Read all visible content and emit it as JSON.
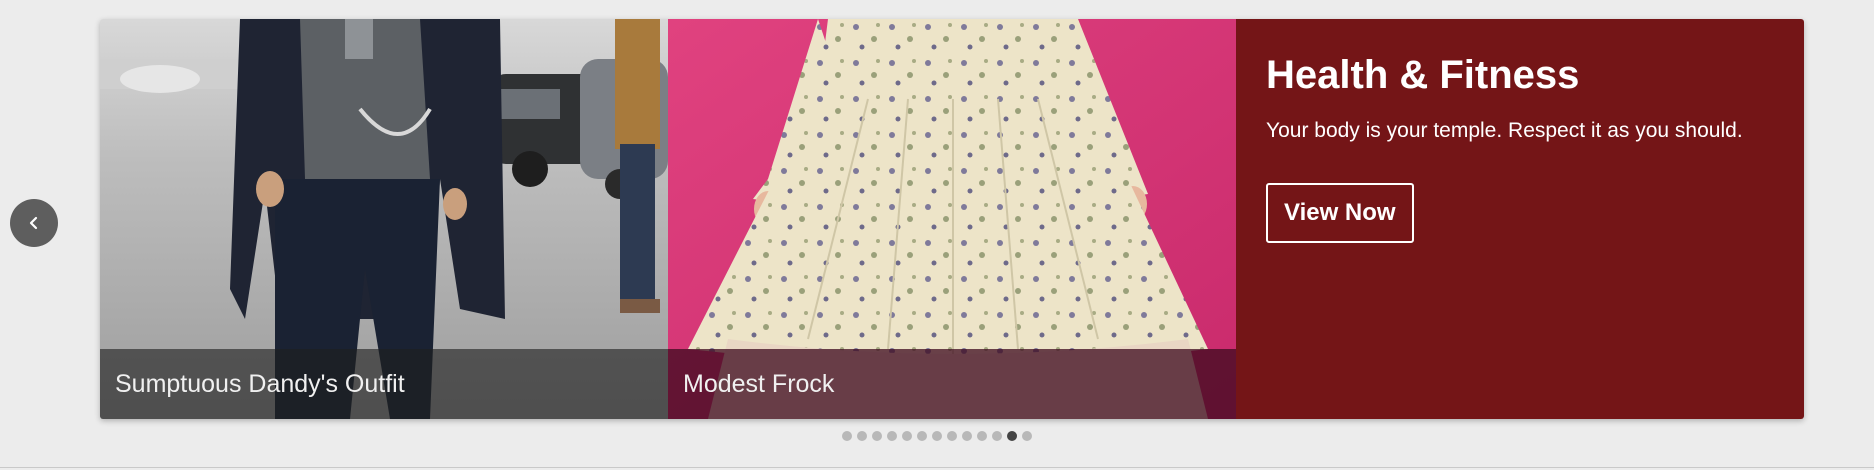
{
  "carousel": {
    "prev_icon": "chevron-left-icon",
    "slides": [
      {
        "caption": "Sumptuous Dandy's Outfit"
      },
      {
        "caption": "Modest Frock"
      }
    ],
    "promo": {
      "title": "Health & Fitness",
      "subtitle": "Your body is your temple. Respect it as you should.",
      "button_label": "View Now",
      "background_color": "#741517"
    },
    "pagination": {
      "total": 13,
      "active_index": 11
    }
  }
}
